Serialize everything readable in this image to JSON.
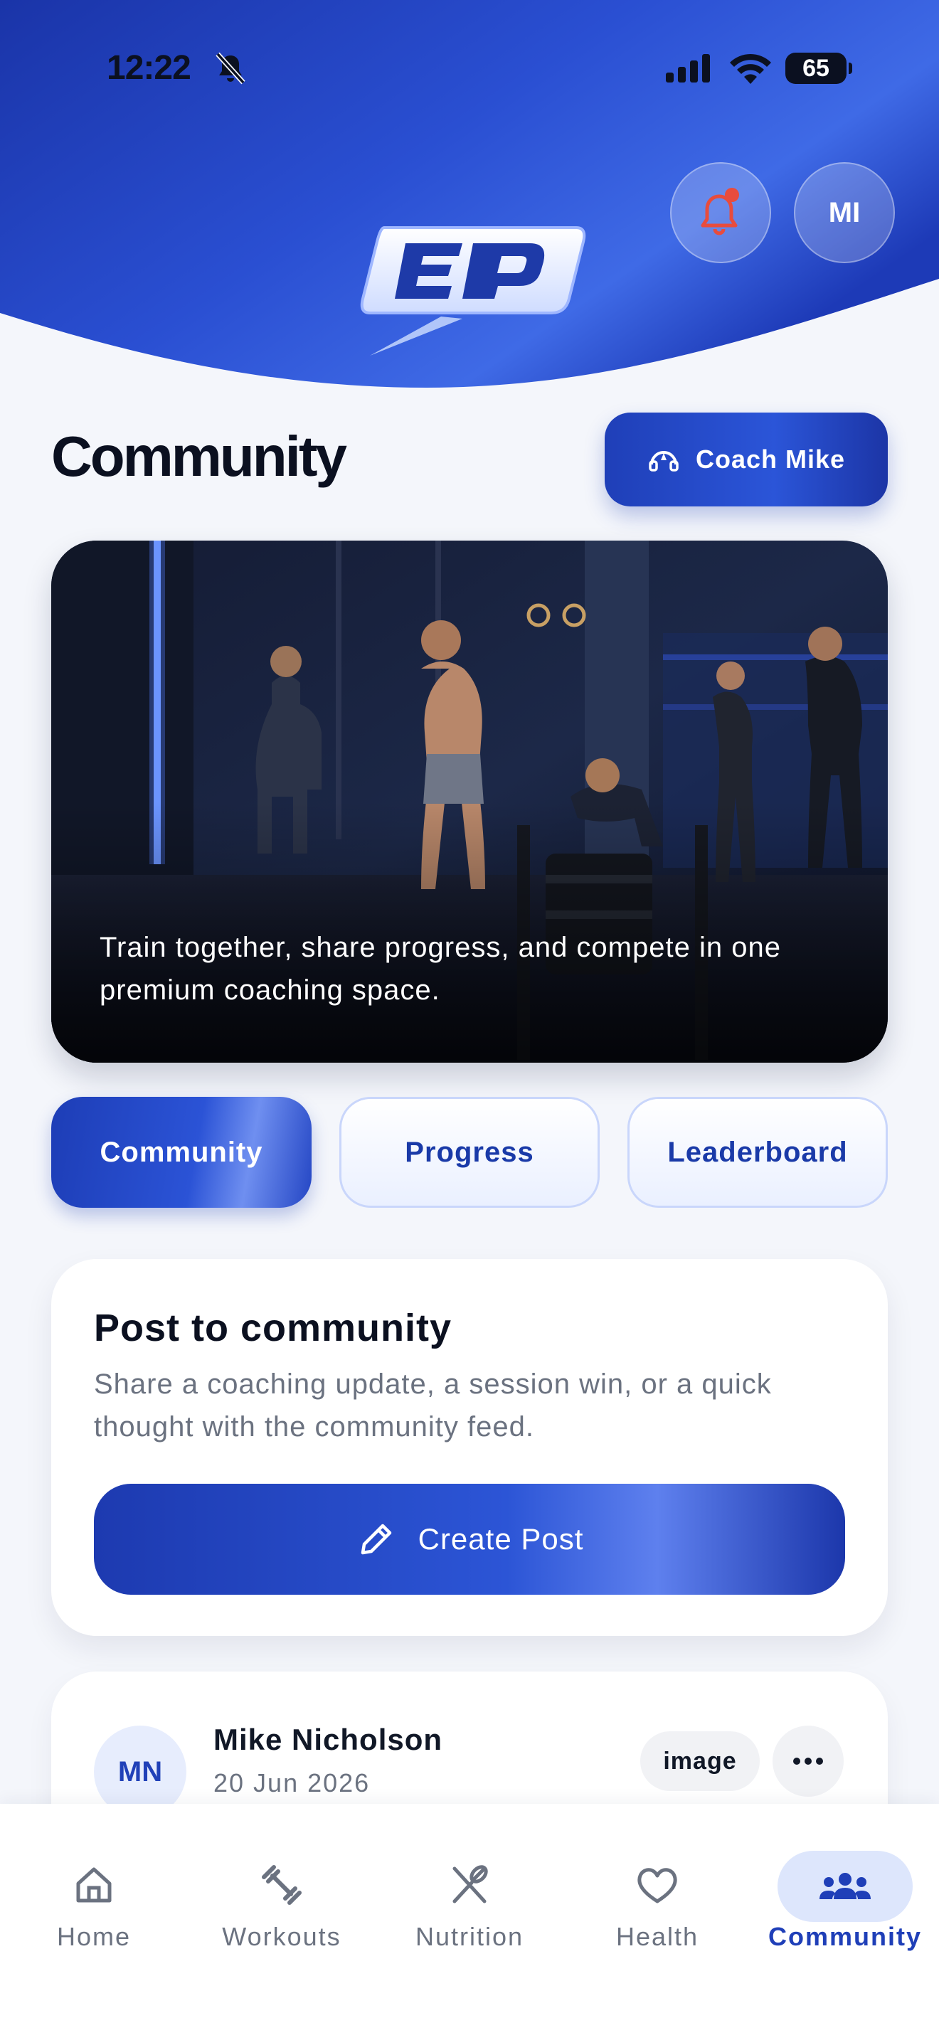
{
  "status_bar": {
    "time": "12:22",
    "battery": "65"
  },
  "header": {
    "avatar_initials": "MI",
    "logo_text": "EP"
  },
  "page": {
    "title": "Community",
    "coach_button": "Coach Mike"
  },
  "hero": {
    "caption": "Train together, share progress, and compete in one premium coaching space."
  },
  "tabs": [
    {
      "label": "Community",
      "active": true
    },
    {
      "label": "Progress",
      "active": false
    },
    {
      "label": "Leaderboard",
      "active": false
    }
  ],
  "post_card": {
    "title": "Post to community",
    "description": "Share a coaching update, a session win, or a quick thought with the community feed.",
    "button": "Create Post"
  },
  "feed": [
    {
      "initials": "MN",
      "name": "Mike Nicholson",
      "date": "20 Jun 2026",
      "badge": "image"
    }
  ],
  "bottom_nav": [
    {
      "label": "Home",
      "icon": "home-icon"
    },
    {
      "label": "Workouts",
      "icon": "dumbbell-icon"
    },
    {
      "label": "Nutrition",
      "icon": "utensils-icon"
    },
    {
      "label": "Health",
      "icon": "heart-icon"
    },
    {
      "label": "Community",
      "icon": "people-icon",
      "active": true
    }
  ],
  "colors": {
    "accent": "#1f3fb8",
    "alert": "#e84c3d",
    "text": "#0b1020"
  }
}
